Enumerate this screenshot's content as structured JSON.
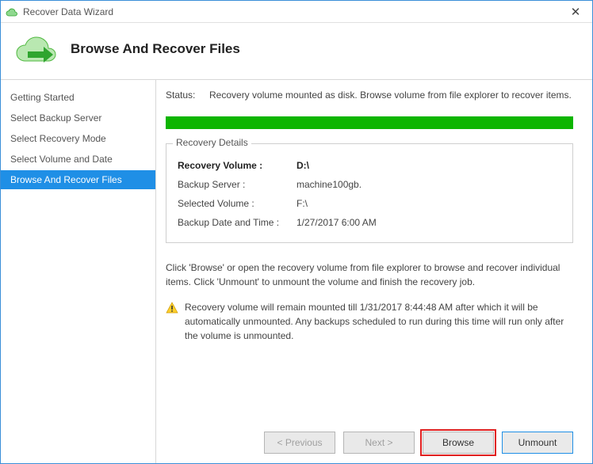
{
  "window": {
    "title": "Recover Data Wizard"
  },
  "header": {
    "heading": "Browse And Recover Files"
  },
  "sidebar": {
    "items": [
      {
        "label": "Getting Started"
      },
      {
        "label": "Select Backup Server"
      },
      {
        "label": "Select Recovery Mode"
      },
      {
        "label": "Select Volume and Date"
      },
      {
        "label": "Browse And Recover Files"
      }
    ]
  },
  "main": {
    "status_label": "Status:",
    "status_text": "Recovery volume mounted as disk. Browse volume from file explorer to recover items.",
    "details_legend": "Recovery Details",
    "details": {
      "recovery_volume_label": "Recovery Volume :",
      "recovery_volume_value": "D:\\",
      "backup_server_label": "Backup Server :",
      "backup_server_value": "machine100gb.",
      "selected_volume_label": "Selected Volume :",
      "selected_volume_value": "F:\\",
      "backup_datetime_label": "Backup Date and Time :",
      "backup_datetime_value": "1/27/2017 6:00 AM"
    },
    "instructions": "Click 'Browse' or open the recovery volume from file explorer to browse and recover individual items. Click 'Unmount' to unmount the volume and finish the recovery job.",
    "warning": "Recovery volume will remain mounted till 1/31/2017 8:44:48 AM after which it will be automatically unmounted. Any backups scheduled to run during this time will run only after the volume is unmounted."
  },
  "buttons": {
    "previous": "< Previous",
    "next": "Next >",
    "browse": "Browse",
    "unmount": "Unmount"
  }
}
